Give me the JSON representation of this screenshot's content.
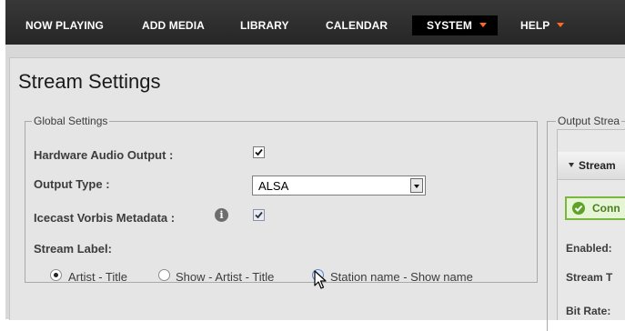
{
  "nav": {
    "items": [
      {
        "label": "NOW PLAYING"
      },
      {
        "label": "ADD MEDIA"
      },
      {
        "label": "LIBRARY"
      },
      {
        "label": "CALENDAR"
      },
      {
        "label": "SYSTEM",
        "active": true,
        "has_dropdown": true
      },
      {
        "label": "HELP",
        "has_dropdown": true
      }
    ],
    "caret_color": "#ff6a1f"
  },
  "page": {
    "title": "Stream Settings"
  },
  "global_settings": {
    "legend": "Global Settings",
    "hardware_audio_output": {
      "label": "Hardware Audio Output :",
      "checked": true
    },
    "output_type": {
      "label": "Output Type :",
      "selected": "ALSA"
    },
    "icecast_vorbis_metadata": {
      "label": "Icecast Vorbis Metadata :",
      "checked": true,
      "info_icon": "info-icon"
    },
    "stream_label": {
      "label": "Stream Label:",
      "options": [
        {
          "label": "Artist - Title",
          "checked": true
        },
        {
          "label": "Show - Artist - Title",
          "checked": false
        },
        {
          "label": "Station name - Show name",
          "checked": false,
          "hovered": true
        }
      ]
    }
  },
  "output_streams": {
    "legend": "Output Strea",
    "stream_header": "Stream",
    "status": "Conn",
    "status_color": "#5ca327",
    "fields": [
      "Enabled:",
      "Stream T",
      "Bit Rate:"
    ]
  }
}
